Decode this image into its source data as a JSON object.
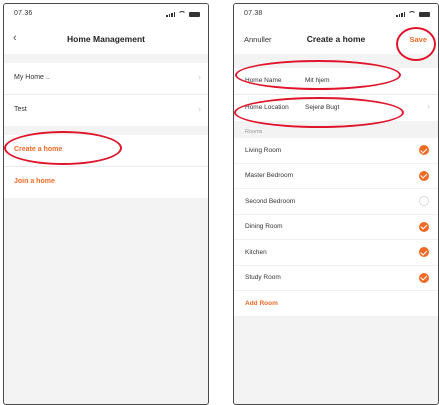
{
  "screen_left": {
    "status_time": "07.36",
    "title": "Home Management",
    "items": [
      {
        "label": "My Home .."
      },
      {
        "label": "Test"
      }
    ],
    "create_label": "Create a home",
    "join_label": "Join a home"
  },
  "screen_right": {
    "status_time": "07.38",
    "cancel_label": "Annuller",
    "title": "Create a home",
    "save_label": "Save",
    "home_name_label": "Home Name",
    "home_name_value": "Mit hjem",
    "home_location_label": "Home Location",
    "home_location_value": "Sejerø Bugt",
    "rooms_caption": "Rooms",
    "rooms": [
      {
        "name": "Living Room",
        "checked": true
      },
      {
        "name": "Master Bedroom",
        "checked": true
      },
      {
        "name": "Second Bedroom",
        "checked": false
      },
      {
        "name": "Dining Room",
        "checked": true
      },
      {
        "name": "Kitchen",
        "checked": true
      },
      {
        "name": "Study Room",
        "checked": true
      }
    ],
    "add_room_label": "Add Room"
  },
  "icons": {
    "back": "chevron-left-icon",
    "row_chevron": "chevron-right-icon",
    "check": "checkmark-circle-icon"
  },
  "colors": {
    "accent": "#f06a24",
    "annotation": "#e0152b",
    "background": "#f3f3f3"
  }
}
